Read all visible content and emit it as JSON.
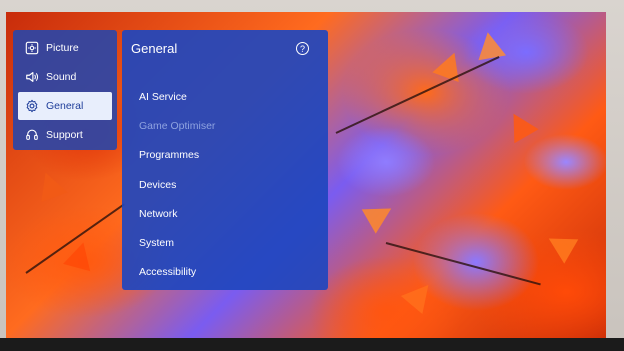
{
  "side_menu": {
    "items": [
      {
        "label": "Picture",
        "icon": "picture-icon",
        "active": false
      },
      {
        "label": "Sound",
        "icon": "speaker-icon",
        "active": false
      },
      {
        "label": "General",
        "icon": "gear-icon",
        "active": true
      },
      {
        "label": "Support",
        "icon": "headset-icon",
        "active": false
      }
    ]
  },
  "main_panel": {
    "title": "General",
    "help_glyph": "?",
    "items": [
      {
        "label": "AI Service",
        "enabled": true
      },
      {
        "label": "Game Optimiser",
        "enabled": false
      },
      {
        "label": "Programmes",
        "enabled": true
      },
      {
        "label": "Devices",
        "enabled": true
      },
      {
        "label": "Network",
        "enabled": true
      },
      {
        "label": "System",
        "enabled": true
      },
      {
        "label": "Accessibility",
        "enabled": true
      }
    ]
  },
  "colors": {
    "panel_blue": "#2046be",
    "active_bg": "#e8eefc",
    "active_text": "#1e3d9a",
    "disabled_text": "#8fa3e0"
  }
}
